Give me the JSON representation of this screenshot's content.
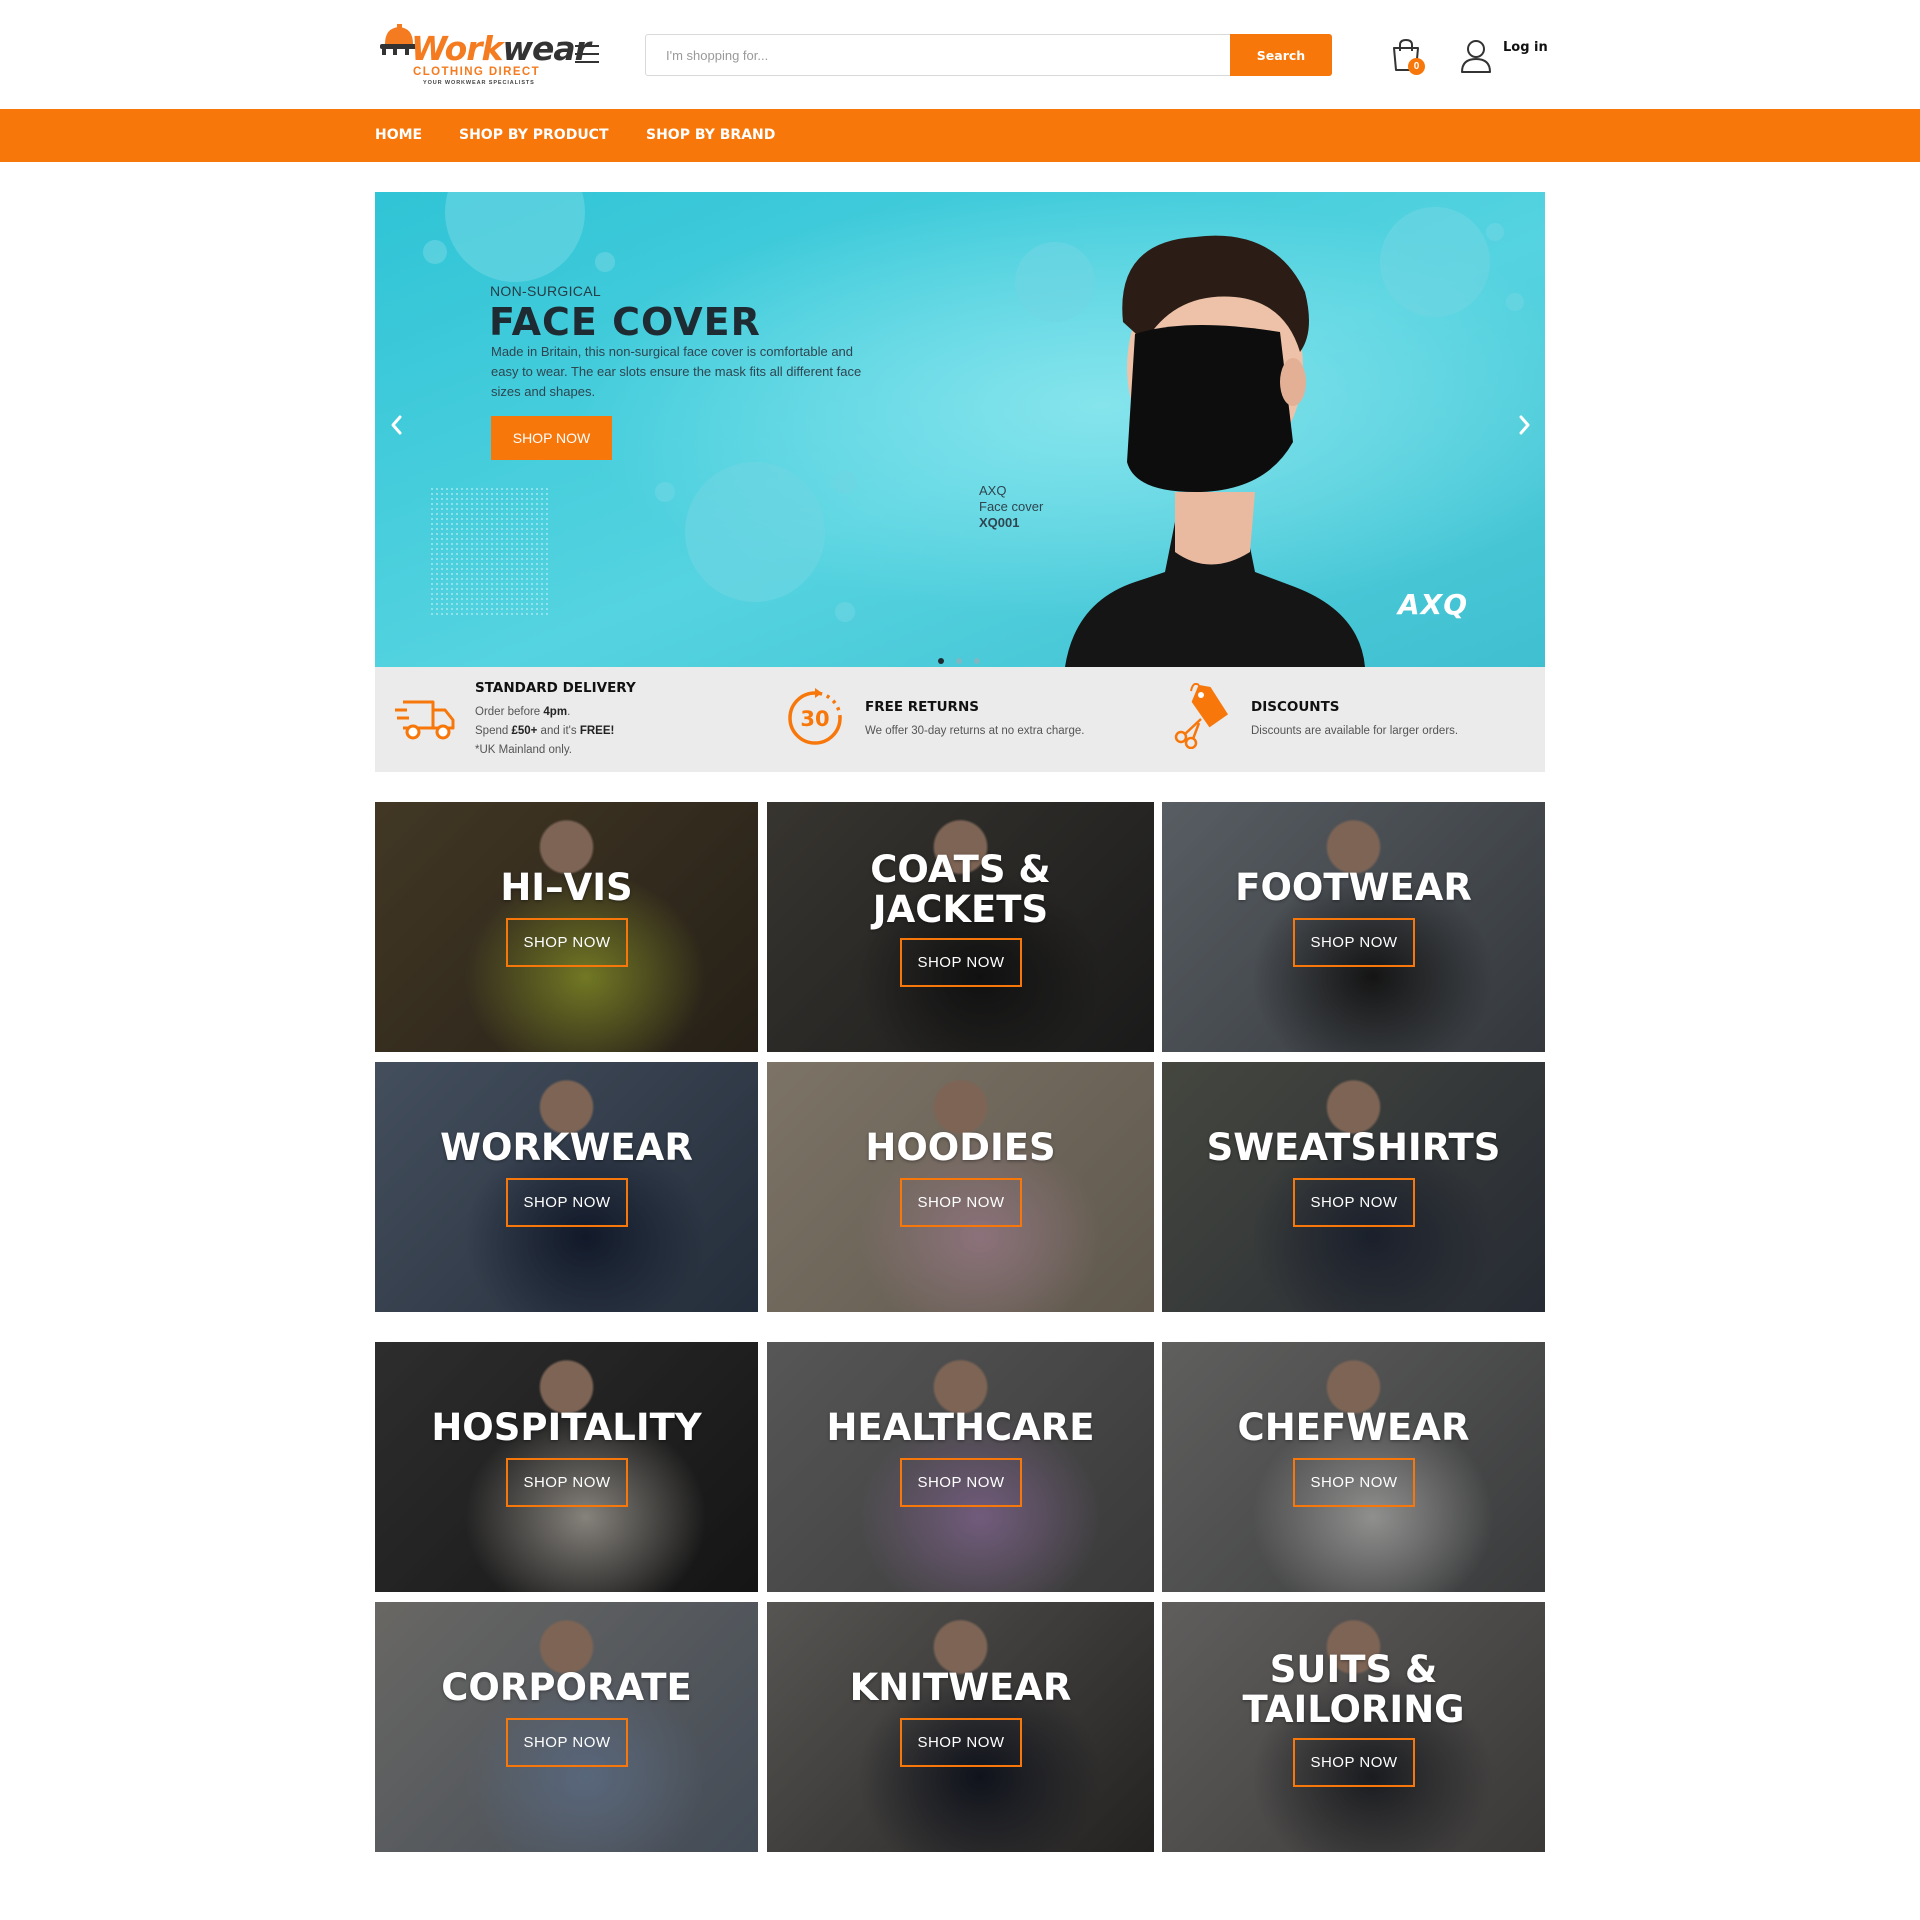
{
  "header": {
    "logo": {
      "word_1": "Work",
      "word_2": "wear",
      "subtitle": "CLOTHING DIRECT",
      "tagline": "YOUR WORKWEAR SPECIALISTS"
    },
    "search": {
      "placeholder": "I'm shopping for...",
      "value": "",
      "button_label": "Search"
    },
    "cart": {
      "count": "0",
      "icon": "shopping-bag-icon"
    },
    "account": {
      "icon": "user-icon",
      "label": "Log in"
    },
    "menu_icon": "hamburger-icon"
  },
  "nav": {
    "items": [
      {
        "label": "HOME"
      },
      {
        "label": "SHOP BY PRODUCT"
      },
      {
        "label": "SHOP BY BRAND"
      }
    ]
  },
  "hero": {
    "kicker": "NON-SURGICAL",
    "title": "FACE COVER",
    "text": "Made in Britain, this non-surgical face cover is comfortable and easy to wear. The ear slots ensure the mask fits all different face sizes and shapes.",
    "button_label": "SHOP NOW",
    "product_brand": "AXQ",
    "product_name": "Face cover",
    "product_code": "XQ001",
    "brand_logo": "AXQ",
    "slides": 3,
    "active_slide": 1
  },
  "features": [
    {
      "icon": "delivery-truck-icon",
      "title": "STANDARD DELIVERY",
      "line1_pre": "Order before ",
      "line1_bold": "4pm",
      "line1_post": ".",
      "line2_pre": "Spend ",
      "line2_bold": "£50+",
      "line2_mid": " and it's ",
      "line2_bold2": "FREE!",
      "line3": "*UK Mainland only."
    },
    {
      "icon": "returns-30-icon",
      "badge": "30",
      "title": "FREE RETURNS",
      "line1": "We offer 30-day returns at no extra charge."
    },
    {
      "icon": "price-tag-scissors-icon",
      "title": "DISCOUNTS",
      "line1": "Discounts are available for larger orders."
    }
  ],
  "categories": [
    {
      "line1": "HI–VIS",
      "line2": "",
      "button": "SHOP NOW"
    },
    {
      "line1": "COATS &",
      "line2": "JACKETS",
      "button": "SHOP NOW"
    },
    {
      "line1": "FOOTWEAR",
      "line2": "",
      "button": "SHOP NOW"
    },
    {
      "line1": "WORKWEAR",
      "line2": "",
      "button": "SHOP NOW"
    },
    {
      "line1": "HOODIES",
      "line2": "",
      "button": "SHOP NOW"
    },
    {
      "line1": "SWEATSHIRTS",
      "line2": "",
      "button": "SHOP NOW"
    },
    {
      "line1": "HOSPITALITY",
      "line2": "",
      "button": "SHOP NOW"
    },
    {
      "line1": "HEALTHCARE",
      "line2": "",
      "button": "SHOP NOW"
    },
    {
      "line1": "CHEFWEAR",
      "line2": "",
      "button": "SHOP NOW"
    },
    {
      "line1": "CORPORATE",
      "line2": "",
      "button": "SHOP NOW"
    },
    {
      "line1": "KNITWEAR",
      "line2": "",
      "button": "SHOP NOW"
    },
    {
      "line1": "SUITS &",
      "line2": "TAILORING",
      "button": "SHOP NOW"
    }
  ],
  "colors": {
    "accent": "#f7770b",
    "hero_bg": "#3dc8d8",
    "strip_bg": "#ebebeb",
    "text_dark": "#1e2b32"
  }
}
